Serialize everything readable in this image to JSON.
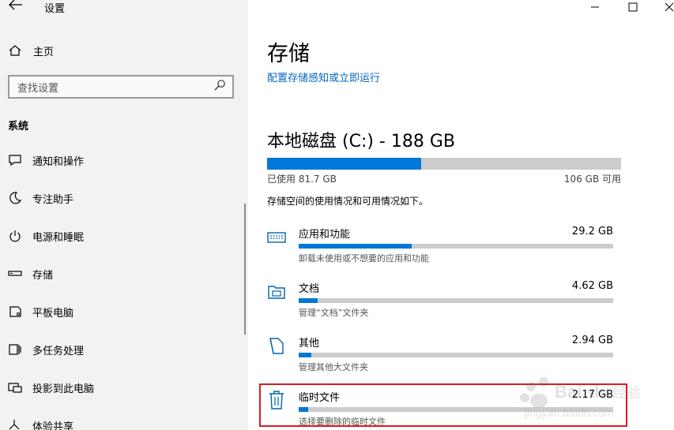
{
  "app": {
    "title": "设置"
  },
  "sidebar": {
    "home_label": "主页",
    "search_placeholder": "查找设置",
    "section_label": "系统",
    "items": [
      {
        "label": "通知和操作",
        "icon": "notification-icon"
      },
      {
        "label": "专注助手",
        "icon": "moon-icon"
      },
      {
        "label": "电源和睡眠",
        "icon": "power-icon"
      },
      {
        "label": "存储",
        "icon": "storage-icon"
      },
      {
        "label": "平板电脑",
        "icon": "tablet-icon"
      },
      {
        "label": "多任务处理",
        "icon": "multitasking-icon"
      },
      {
        "label": "投影到此电脑",
        "icon": "project-icon"
      },
      {
        "label": "体验共享",
        "icon": "share-icon"
      }
    ]
  },
  "main": {
    "title": "存储",
    "config_link": "配置存储感知或立即运行",
    "disk": {
      "title": "本地磁盘 (C:) - 188 GB",
      "used_label": "已使用 81.7 GB",
      "free_label": "106 GB 可用",
      "used_fraction": 0.435
    },
    "description": "存储空间的使用情况和可用情况如下。",
    "categories": [
      {
        "name": "应用和功能",
        "size": "29.2 GB",
        "sub": "卸载未使用或不想要的应用和功能",
        "fraction": 0.36,
        "icon": "apps-icon"
      },
      {
        "name": "文档",
        "size": "4.62 GB",
        "sub": "管理“文档”文件夹",
        "fraction": 0.06,
        "icon": "documents-folder-icon"
      },
      {
        "name": "其他",
        "size": "2.94 GB",
        "sub": "管理其他大文件夹",
        "fraction": 0.04,
        "icon": "other-files-icon"
      },
      {
        "name": "临时文件",
        "size": "2.17 GB",
        "sub": "选择要删除的临时文件",
        "fraction": 0.03,
        "icon": "trash-icon"
      }
    ]
  },
  "colors": {
    "accent": "#0078d7",
    "link": "#0067c0",
    "highlight": "#d91c24"
  },
  "watermark": {
    "text": "Baidu经验",
    "sub": "jingyan.baidu.com"
  }
}
